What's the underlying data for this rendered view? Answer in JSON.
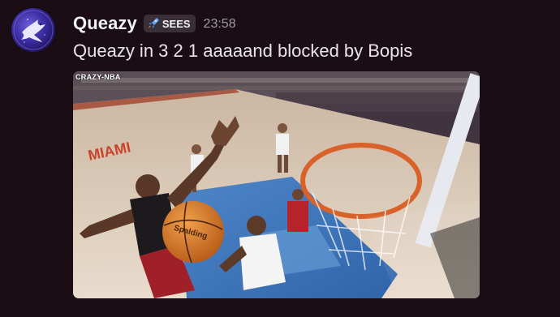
{
  "message": {
    "username": "Queazy",
    "tag_label": "SEES",
    "timestamp": "23:58",
    "content": "Queazy in 3 2 1 aaaaand blocked by Bopis"
  },
  "attachment": {
    "watermark": "CRAZY-NBA",
    "ball_text": "Spalding"
  },
  "colors": {
    "background": "#1a0d14",
    "username": "#f2f3f5",
    "tag_bg": "#3a2f37",
    "tag_icon": "#6aa6f0",
    "timestamp": "#9b9aa3"
  }
}
